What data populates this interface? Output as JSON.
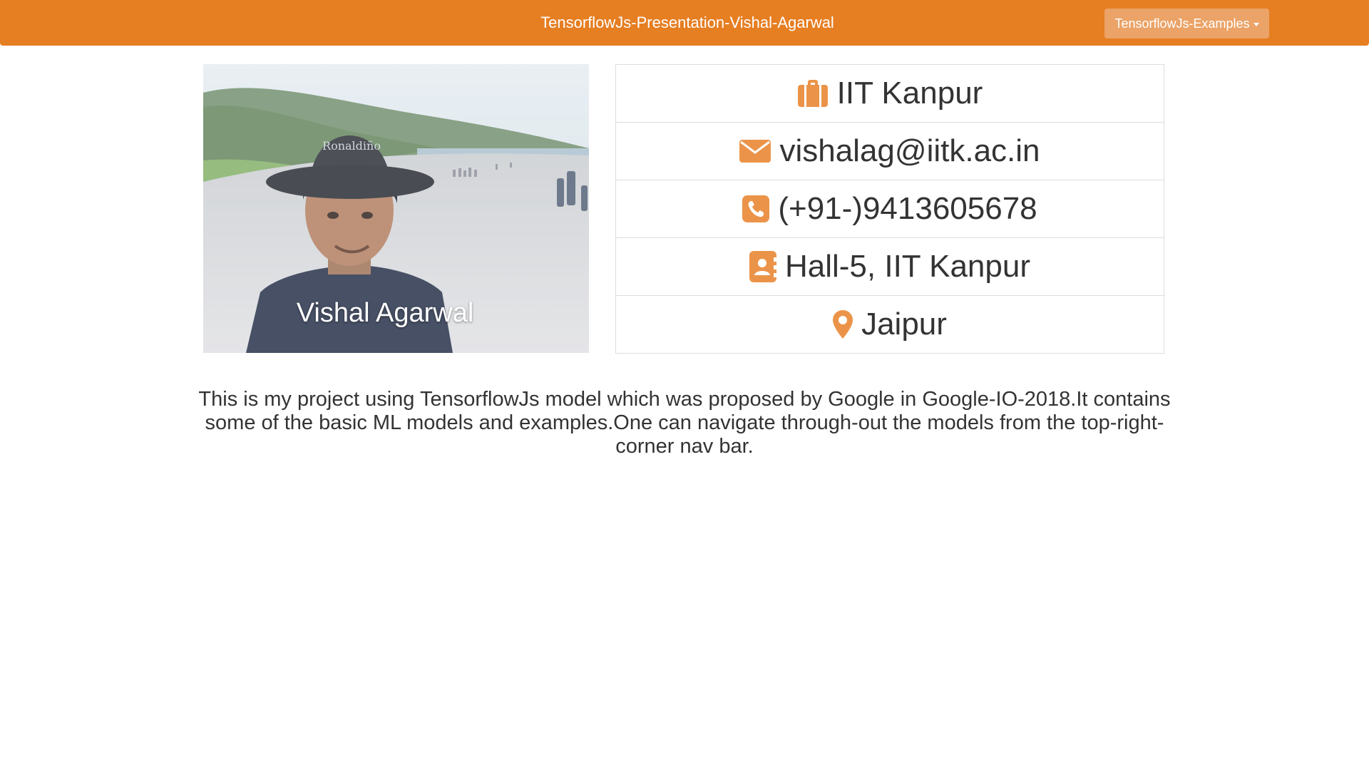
{
  "navbar": {
    "title": "TensorflowJs-Presentation-Vishal-Agarwal",
    "dropdown_label": "TensorflowJs-Examples"
  },
  "profile": {
    "photo_caption": "Vishal Agarwal",
    "hat_text": "Ronaldiño"
  },
  "info": [
    {
      "icon": "briefcase-icon",
      "text": "IIT Kanpur"
    },
    {
      "icon": "envelope-icon",
      "text": "vishalag@iitk.ac.in"
    },
    {
      "icon": "phone-icon",
      "text": "(+91-)9413605678"
    },
    {
      "icon": "address-book-icon",
      "text": "Hall-5, IIT Kanpur"
    },
    {
      "icon": "map-marker-icon",
      "text": "Jaipur"
    }
  ],
  "description": "This is my project using TensorflowJs model which was proposed by Google in Google-IO-2018.It contains some of the basic ML models and examples.One can navigate through-out the models from the top-right-corner nav bar.",
  "colors": {
    "accent": "#e67e22",
    "icon": "#eb9449",
    "dropdown_bg": "#eba367"
  }
}
